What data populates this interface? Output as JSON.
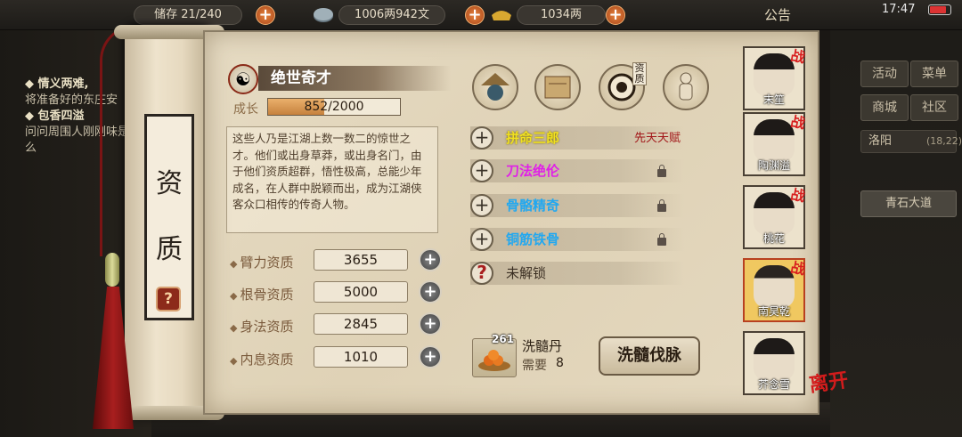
{
  "topbar": {
    "resource1_partial": "储存 21/240",
    "currency_copper": "1006两942文",
    "currency_silver": "1034两",
    "notice": "公告",
    "clock": "17:47"
  },
  "quests": [
    {
      "title": "情义两难,",
      "desc": "将准备好的东庄安"
    },
    {
      "title": "包香四溢",
      "desc": "问问周围人刚刚味是什么"
    }
  ],
  "right_menu": {
    "buttons": [
      "活动",
      "菜单",
      "商城",
      "社区"
    ],
    "location": "洛阳",
    "location_count": "(18,22)",
    "road": "青石大道"
  },
  "scroll_title": "资质",
  "trait": {
    "name": "绝世奇才",
    "growth_label": "成长",
    "growth_value": "852/2000",
    "growth_current": 852,
    "growth_max": 2000,
    "description": "这些人乃是江湖上数一数二的惊世之才。他们或出身草莽，或出身名门，由于他们资质超群，悟性极高，总能少年成名，在人群中脱颖而出，成为江湖侠客众口相传的传奇人物。"
  },
  "stats": [
    {
      "label": "臂力资质",
      "value": "3655"
    },
    {
      "label": "根骨资质",
      "value": "5000"
    },
    {
      "label": "身法资质",
      "value": "2845"
    },
    {
      "label": "内息资质",
      "value": "1010"
    }
  ],
  "categories": {
    "zizhi_label": "资质"
  },
  "talents": [
    {
      "name": "拼命三郎",
      "tag": "先天天赋",
      "color": "#f0e020",
      "locked": false
    },
    {
      "name": "刀法绝伦",
      "tag": "",
      "color": "#e020e8",
      "locked": true
    },
    {
      "name": "骨骼精奇",
      "tag": "",
      "color": "#22a8f0",
      "locked": true
    },
    {
      "name": "铜筋铁骨",
      "tag": "",
      "color": "#22a8f0",
      "locked": true
    },
    {
      "name": "未解锁",
      "tag": "",
      "color": "#3a2e22",
      "locked": false
    }
  ],
  "pill": {
    "count": "261",
    "name": "洗髓丹",
    "need_label": "需要",
    "need_value": "8"
  },
  "refine_button": "洗髓伐脉",
  "roster": [
    {
      "name": "末笙",
      "war": "战",
      "selected": false
    },
    {
      "name": "陶渊溢",
      "war": "战",
      "selected": false
    },
    {
      "name": "桃花",
      "war": "战",
      "selected": false
    },
    {
      "name": "南昊乾",
      "war": "战",
      "selected": true
    },
    {
      "name": "芥念雪",
      "war": "",
      "selected": false
    }
  ],
  "leave_tag": "离开"
}
